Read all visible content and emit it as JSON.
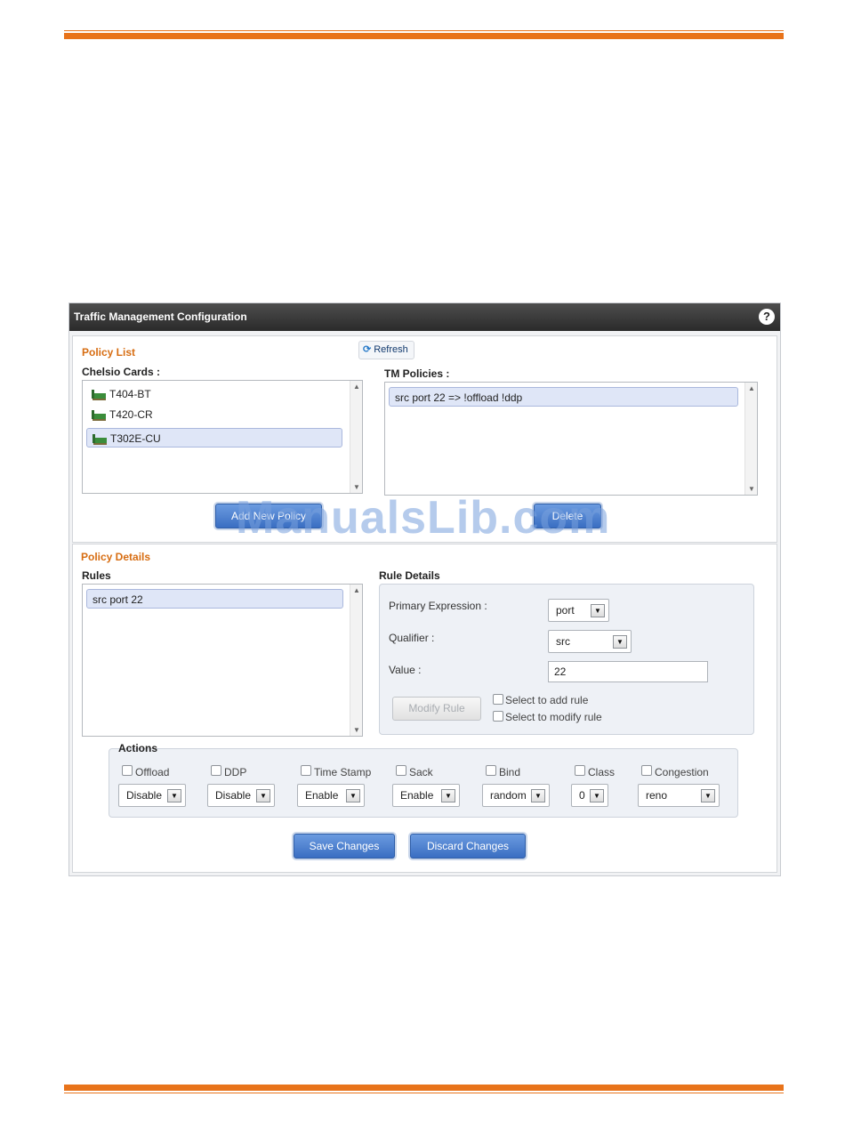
{
  "panel": {
    "title": "Traffic Management Configuration",
    "help_glyph": "?"
  },
  "policy_list": {
    "title": "Policy List",
    "refresh_label": "Refresh",
    "cards_label": "Chelsio Cards :",
    "cards": [
      "T404-BT",
      "T420-CR",
      "T302E-CU"
    ],
    "selected_card": "T302E-CU",
    "tm_policies_label": "TM Policies :",
    "policies": [
      "src port 22 => !offload !ddp"
    ],
    "add_button_label": "Add New Policy",
    "delete_button_label": "Delete"
  },
  "policy_details": {
    "title": "Policy Details",
    "rules_label": "Rules",
    "rules": [
      "src port 22"
    ],
    "rule_details_label": "Rule Details",
    "primary_expression_label": "Primary Expression :",
    "primary_expression_value": "port",
    "qualifier_label": "Qualifier :",
    "qualifier_value": "src",
    "value_label": "Value :",
    "value_value": "22",
    "modify_rule_label": "Modify Rule",
    "select_add_label": "Select to add rule",
    "select_modify_label": "Select to modify rule"
  },
  "actions": {
    "legend": "Actions",
    "items": [
      {
        "label": "Offload",
        "value": "Disable"
      },
      {
        "label": "DDP",
        "value": "Disable"
      },
      {
        "label": "Time Stamp",
        "value": "Enable"
      },
      {
        "label": "Sack",
        "value": "Enable"
      },
      {
        "label": "Bind",
        "value": "random"
      },
      {
        "label": "Class",
        "value": "0"
      },
      {
        "label": "Congestion",
        "value": "reno"
      }
    ]
  },
  "footer": {
    "save_label": "Save Changes",
    "discard_label": "Discard Changes"
  },
  "watermark": "ManualsLib.com",
  "colors": {
    "accent_orange": "#e8731a",
    "section_title": "#d76d12",
    "button_blue": "#3a6ec2"
  }
}
